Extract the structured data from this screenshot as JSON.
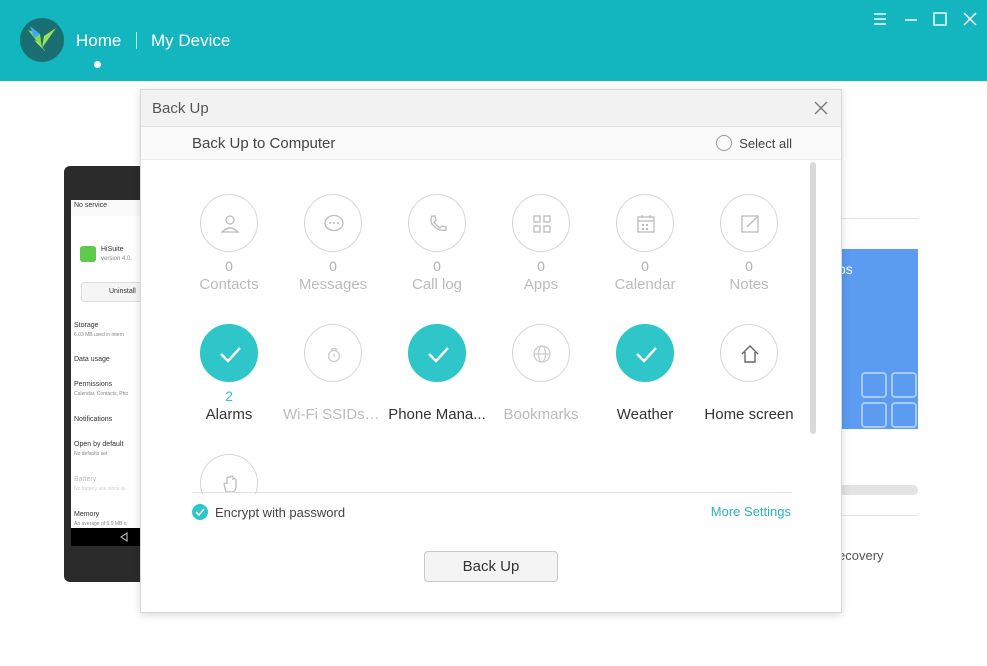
{
  "topbar": {
    "nav_home": "Home",
    "nav_device": "My Device",
    "accent": "#13b5bf"
  },
  "background": {
    "card_text": "ps",
    "recovery_text": "ecovery",
    "phone": {
      "status": "No service",
      "app_name": "HiSuite",
      "app_version": "version 4.0.",
      "uninstall": "Uninstall",
      "storage": "Storage",
      "storage_sub": "6.03 MB used in intern",
      "data_usage": "Data usage",
      "permissions": "Permissions",
      "permissions_sub": "Calendar, Contacts, Pho",
      "notifications": "Notifications",
      "open_default": "Open by default",
      "open_default_sub": "No defaults set",
      "battery": "Battery",
      "battery_sub": "No battery use since la",
      "memory": "Memory",
      "memory_sub": "An average of 5.9 MB o"
    }
  },
  "dialog": {
    "title": "Back Up",
    "subtitle": "Back Up to Computer",
    "select_all": "Select all",
    "items": [
      {
        "label": "Contacts",
        "count": "0",
        "icon": "contact-icon",
        "checked": false,
        "enabled": false
      },
      {
        "label": "Messages",
        "count": "0",
        "icon": "message-icon",
        "checked": false,
        "enabled": false
      },
      {
        "label": "Call log",
        "count": "0",
        "icon": "phone-icon",
        "checked": false,
        "enabled": false
      },
      {
        "label": "Apps",
        "count": "0",
        "icon": "apps-icon",
        "checked": false,
        "enabled": false
      },
      {
        "label": "Calendar",
        "count": "0",
        "icon": "calendar-icon",
        "checked": false,
        "enabled": false
      },
      {
        "label": "Notes",
        "count": "0",
        "icon": "notes-icon",
        "checked": false,
        "enabled": false
      },
      {
        "label": "Alarms",
        "count": "2",
        "icon": "check-icon",
        "checked": true,
        "enabled": true
      },
      {
        "label": "Wi-Fi SSIDs a...",
        "count": "",
        "icon": "wifi-lock-icon",
        "checked": false,
        "enabled": false
      },
      {
        "label": "Phone Mana...",
        "count": "",
        "icon": "check-icon",
        "checked": true,
        "enabled": true
      },
      {
        "label": "Bookmarks",
        "count": "",
        "icon": "globe-icon",
        "checked": false,
        "enabled": false
      },
      {
        "label": "Weather",
        "count": "",
        "icon": "check-icon",
        "checked": true,
        "enabled": true
      },
      {
        "label": "Home screen",
        "count": "",
        "icon": "home-icon",
        "checked": false,
        "enabled": true
      },
      {
        "label": "",
        "count": "",
        "icon": "hand-icon",
        "checked": false,
        "enabled": false
      }
    ],
    "encrypt_label": "Encrypt with password",
    "more_settings": "More Settings",
    "backup_button": "Back Up"
  }
}
